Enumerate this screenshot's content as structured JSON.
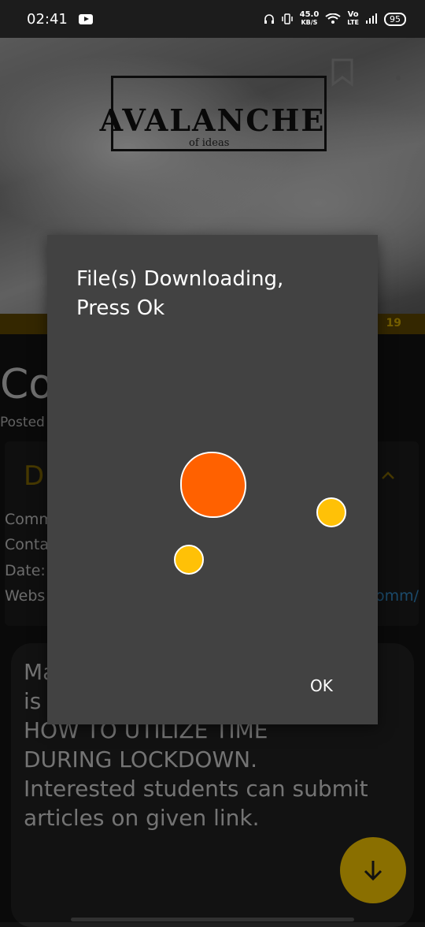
{
  "status_bar": {
    "time": "02:41",
    "net_speed": "45.0",
    "net_speed_unit": "KB/S",
    "volte_top": "Vo",
    "volte_bottom": "LTE",
    "battery": "95"
  },
  "header": {
    "logo_text": "AVALANCHE",
    "logo_subtext": "of ideas",
    "strip_text": "19"
  },
  "article": {
    "title_partial": "Co",
    "posted_partial": "Posted",
    "card_heading_partial": "D",
    "info_lines": [
      "Comm",
      "Conta",
      "Date:",
      "Webs"
    ],
    "link_tail": "omm/"
  },
  "notice": {
    "text": "Ma                              e\nis\nHOW TO UTILIZE TIME\nDURING LOCKDOWN.\nInterested students can submit\narticles on given link."
  },
  "dialog": {
    "title": "File(s) Downloading,\nPress Ok",
    "ok_label": "OK"
  },
  "colors": {
    "dialog_bg": "#424242",
    "accent_orange": "#ff6100",
    "accent_yellow": "#ffc107",
    "fab_bg": "#8a6f00"
  }
}
